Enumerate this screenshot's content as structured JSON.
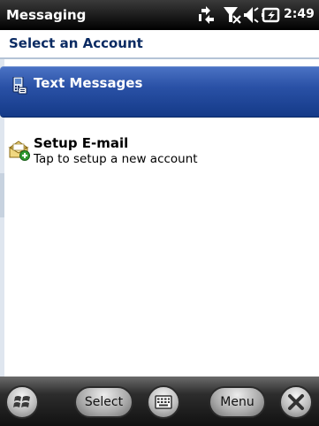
{
  "status_bar": {
    "app_title": "Messaging",
    "time": "2:49",
    "icons": [
      "data-connection-icon",
      "signal-off-icon",
      "volume-icon",
      "battery-charging-icon"
    ]
  },
  "header": {
    "title": "Select an Account"
  },
  "accounts": [
    {
      "title": "Text Messages",
      "subtitle": "",
      "icon": "sms-icon",
      "selected": true
    },
    {
      "title": "Setup E-mail",
      "subtitle": "Tap to setup a new account",
      "icon": "setup-email-icon",
      "selected": false
    }
  ],
  "softkeys": {
    "left_label": "Select",
    "right_label": "Menu",
    "icons": [
      "windows-start-icon",
      "keyboard-icon",
      "close-icon"
    ]
  },
  "colors": {
    "selection": "#2a51a6",
    "header_text": "#0b2b63",
    "status_bar": "#000000",
    "softkey_bar": "#2d2d2d"
  }
}
